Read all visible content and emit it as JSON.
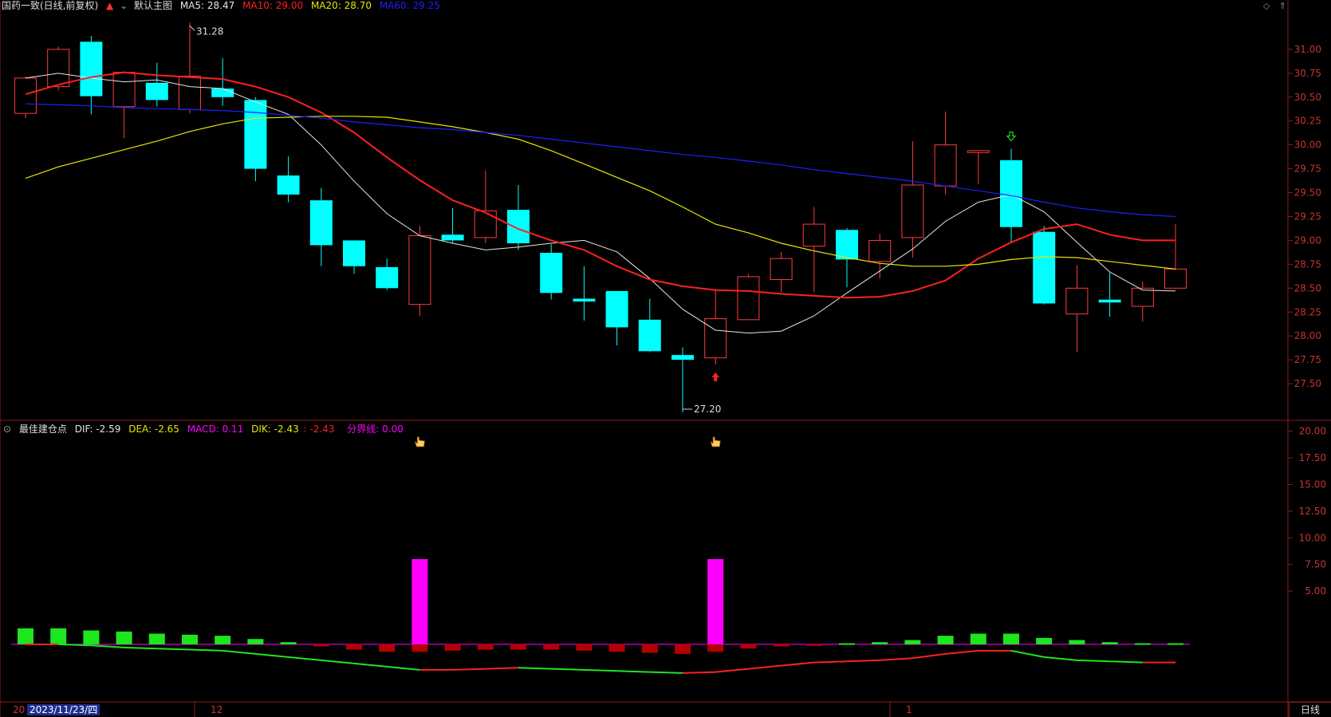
{
  "main_header": {
    "title": "国药一致(日线,前复权)",
    "template": "默认主图",
    "ma5": "MA5: 28.47",
    "ma10": "MA10: 29.00",
    "ma20": "MA20: 28.70",
    "ma60": "MA60: 29.25"
  },
  "sub_header": {
    "indicator": "最佳建仓点",
    "dif": "DIF: -2.59",
    "dea": "DEA: -2.65",
    "macd": "MACD: 0.11",
    "dik": "DIK: -2.43",
    "dik2": ": -2.43",
    "boundary": "分界线: 0.00"
  },
  "colors": {
    "up": "#ff3c3c",
    "down": "#00ffff",
    "ma5": "#e6e6e6",
    "ma10": "#ff2020",
    "ma20": "#e6e600",
    "ma60": "#1e1eff",
    "axis": "#8b1b1b",
    "signal_bar": "#ff00ff"
  },
  "footer": {
    "date_prefix": "20",
    "cursor_date": "2023/11/23/四",
    "month_dec": "12",
    "month_jan": "1",
    "period_button": "日线"
  },
  "annotations": {
    "high_label": "31.28",
    "low_label": "27.20"
  },
  "chart_data": [
    {
      "type": "candlestick",
      "title": "国药一致(日线,前复权)",
      "y_ticks": [
        31.0,
        30.75,
        30.5,
        30.25,
        30.0,
        29.75,
        29.5,
        29.25,
        29.0,
        28.75,
        28.5,
        28.25,
        28.0,
        27.75,
        27.5
      ],
      "y_range": [
        27.2,
        31.3
      ],
      "candles": [
        {
          "o": 30.33,
          "h": 30.72,
          "l": 30.28,
          "c": 30.7
        },
        {
          "o": 30.61,
          "h": 31.03,
          "l": 30.57,
          "c": 31.0
        },
        {
          "o": 31.08,
          "h": 31.14,
          "l": 30.32,
          "c": 30.51
        },
        {
          "o": 30.4,
          "h": 30.77,
          "l": 30.07,
          "c": 30.76
        },
        {
          "o": 30.65,
          "h": 30.86,
          "l": 30.4,
          "c": 30.47
        },
        {
          "o": 30.37,
          "h": 31.28,
          "l": 30.33,
          "c": 30.72
        },
        {
          "o": 30.59,
          "h": 30.91,
          "l": 30.41,
          "c": 30.5
        },
        {
          "o": 30.47,
          "h": 30.5,
          "l": 29.62,
          "c": 29.75
        },
        {
          "o": 29.68,
          "h": 29.88,
          "l": 29.4,
          "c": 29.48
        },
        {
          "o": 29.42,
          "h": 29.55,
          "l": 28.73,
          "c": 28.95
        },
        {
          "o": 29.0,
          "h": 29.0,
          "l": 28.65,
          "c": 28.73
        },
        {
          "o": 28.72,
          "h": 28.81,
          "l": 28.48,
          "c": 28.5
        },
        {
          "o": 28.33,
          "h": 29.15,
          "l": 28.21,
          "c": 29.05
        },
        {
          "o": 29.06,
          "h": 29.34,
          "l": 28.97,
          "c": 29.0
        },
        {
          "o": 29.03,
          "h": 29.73,
          "l": 28.97,
          "c": 29.31
        },
        {
          "o": 29.32,
          "h": 29.58,
          "l": 28.9,
          "c": 28.97
        },
        {
          "o": 28.87,
          "h": 28.96,
          "l": 28.38,
          "c": 28.45
        },
        {
          "o": 28.39,
          "h": 28.73,
          "l": 28.16,
          "c": 28.36
        },
        {
          "o": 28.47,
          "h": 28.47,
          "l": 27.9,
          "c": 28.09
        },
        {
          "o": 28.17,
          "h": 28.39,
          "l": 27.83,
          "c": 27.84
        },
        {
          "o": 27.8,
          "h": 27.88,
          "l": 27.2,
          "c": 27.75
        },
        {
          "o": 27.77,
          "h": 28.49,
          "l": 27.7,
          "c": 28.18
        },
        {
          "o": 28.17,
          "h": 28.65,
          "l": 28.17,
          "c": 28.62
        },
        {
          "o": 28.59,
          "h": 28.88,
          "l": 28.46,
          "c": 28.81
        },
        {
          "o": 28.94,
          "h": 29.35,
          "l": 28.46,
          "c": 29.17
        },
        {
          "o": 29.11,
          "h": 29.13,
          "l": 28.51,
          "c": 28.8
        },
        {
          "o": 28.78,
          "h": 29.07,
          "l": 28.6,
          "c": 29.0
        },
        {
          "o": 29.03,
          "h": 30.04,
          "l": 28.82,
          "c": 29.58
        },
        {
          "o": 29.57,
          "h": 30.35,
          "l": 29.48,
          "c": 30.0
        },
        {
          "o": 29.92,
          "h": 29.95,
          "l": 29.59,
          "c": 29.94
        },
        {
          "o": 29.84,
          "h": 29.96,
          "l": 28.97,
          "c": 29.14
        },
        {
          "o": 29.09,
          "h": 29.15,
          "l": 28.33,
          "c": 28.34
        },
        {
          "o": 28.23,
          "h": 28.74,
          "l": 27.83,
          "c": 28.5
        },
        {
          "o": 28.38,
          "h": 28.66,
          "l": 28.2,
          "c": 28.35
        },
        {
          "o": 28.31,
          "h": 28.57,
          "l": 28.15,
          "c": 28.5
        },
        {
          "o": 28.5,
          "h": 29.17,
          "l": 28.5,
          "c": 28.7
        }
      ],
      "series": [
        {
          "name": "MA5",
          "values": [
            30.7,
            30.75,
            30.7,
            30.66,
            30.68,
            30.61,
            30.59,
            30.45,
            30.32,
            30.0,
            29.62,
            29.28,
            29.05,
            28.97,
            28.9,
            28.93,
            28.97,
            29.0,
            28.88,
            28.6,
            28.28,
            28.06,
            28.03,
            28.05,
            28.21,
            28.45,
            28.68,
            28.91,
            29.2,
            29.4,
            29.48,
            29.3,
            28.98,
            28.67,
            28.48,
            28.47
          ]
        },
        {
          "name": "MA10",
          "values": [
            30.53,
            30.63,
            30.71,
            30.76,
            30.73,
            30.71,
            30.69,
            30.61,
            30.5,
            30.34,
            30.13,
            29.87,
            29.63,
            29.42,
            29.29,
            29.12,
            29.0,
            28.9,
            28.73,
            28.59,
            28.52,
            28.48,
            28.47,
            28.44,
            28.42,
            28.4,
            28.41,
            28.47,
            28.58,
            28.81,
            28.98,
            29.12,
            29.17,
            29.06,
            29.0,
            29.0
          ]
        },
        {
          "name": "MA20",
          "values": [
            29.65,
            29.77,
            29.86,
            29.95,
            30.04,
            30.14,
            30.22,
            30.28,
            30.29,
            30.3,
            30.3,
            30.29,
            30.24,
            30.19,
            30.13,
            30.06,
            29.94,
            29.8,
            29.66,
            29.52,
            29.35,
            29.17,
            29.08,
            28.97,
            28.89,
            28.82,
            28.76,
            28.73,
            28.73,
            28.75,
            28.8,
            28.83,
            28.82,
            28.78,
            28.74,
            28.7
          ]
        },
        {
          "name": "MA60",
          "values": [
            30.43,
            30.42,
            30.41,
            30.39,
            30.38,
            30.37,
            30.36,
            30.34,
            30.31,
            30.28,
            30.24,
            30.21,
            30.18,
            30.16,
            30.13,
            30.1,
            30.06,
            30.02,
            29.98,
            29.94,
            29.9,
            29.87,
            29.83,
            29.79,
            29.74,
            29.7,
            29.66,
            29.62,
            29.57,
            29.52,
            29.47,
            29.4,
            29.34,
            29.3,
            29.27,
            29.25
          ]
        }
      ]
    },
    {
      "type": "bar",
      "title": "最佳建仓点",
      "y_ticks": [
        20.0,
        17.5,
        15.0,
        12.5,
        10.0,
        7.5,
        5.0
      ],
      "y_range": [
        -5.4,
        20.8
      ],
      "macd_bars": [
        1.5,
        1.5,
        1.3,
        1.2,
        1.0,
        0.9,
        0.8,
        0.5,
        0.2,
        -0.2,
        -0.5,
        -0.7,
        -0.7,
        -0.6,
        -0.5,
        -0.5,
        -0.5,
        -0.6,
        -0.7,
        -0.8,
        -0.9,
        -0.7,
        -0.4,
        -0.2,
        -0.1,
        0.1,
        0.2,
        0.4,
        0.8,
        1.0,
        1.0,
        0.6,
        0.4,
        0.2,
        0.1,
        0.1
      ],
      "signal_bars": [
        0,
        0,
        0,
        0,
        0,
        0,
        0,
        0,
        0,
        0,
        0,
        0,
        8.0,
        0,
        0,
        0,
        0,
        0,
        0,
        0,
        0,
        8.0,
        0,
        0,
        0,
        0,
        0,
        0,
        0,
        0,
        0,
        0,
        0,
        0,
        0,
        0
      ],
      "dik_line": [
        0.0,
        0.0,
        -0.1,
        -0.3,
        -0.4,
        -0.5,
        -0.6,
        -0.9,
        -1.2,
        -1.5,
        -1.8,
        -2.1,
        -2.4,
        -2.4,
        -2.3,
        -2.2,
        -2.3,
        -2.4,
        -2.5,
        -2.6,
        -2.7,
        -2.6,
        -2.3,
        -2.0,
        -1.7,
        -1.6,
        -1.5,
        -1.3,
        -0.9,
        -0.6,
        -0.6,
        -1.2,
        -1.5,
        -1.6,
        -1.7,
        -1.7
      ]
    }
  ]
}
